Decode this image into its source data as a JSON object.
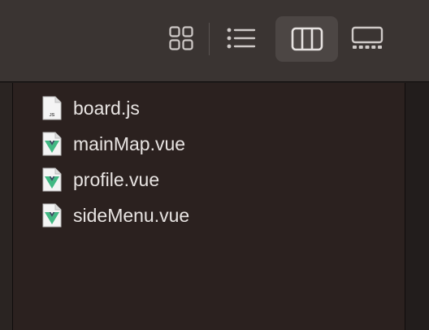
{
  "toolbar": {
    "view_buttons": [
      {
        "icon": "grid-view-icon",
        "selected": false
      },
      {
        "icon": "list-view-icon",
        "selected": false
      },
      {
        "icon": "column-view-icon",
        "selected": true
      },
      {
        "icon": "gallery-view-icon",
        "selected": false
      }
    ]
  },
  "colors": {
    "toolbar_bg": "#3a3432",
    "pane_bg": "#2b211f",
    "selected_bg": "#4c4644",
    "text": "#e8e4e2",
    "vue_green": "#41b883",
    "vue_dark": "#35495e"
  },
  "files": [
    {
      "name": "board.js",
      "icon": "js-file-icon",
      "badge": "JS"
    },
    {
      "name": "mainMap.vue",
      "icon": "vue-file-icon"
    },
    {
      "name": "profile.vue",
      "icon": "vue-file-icon"
    },
    {
      "name": "sideMenu.vue",
      "icon": "vue-file-icon"
    }
  ]
}
